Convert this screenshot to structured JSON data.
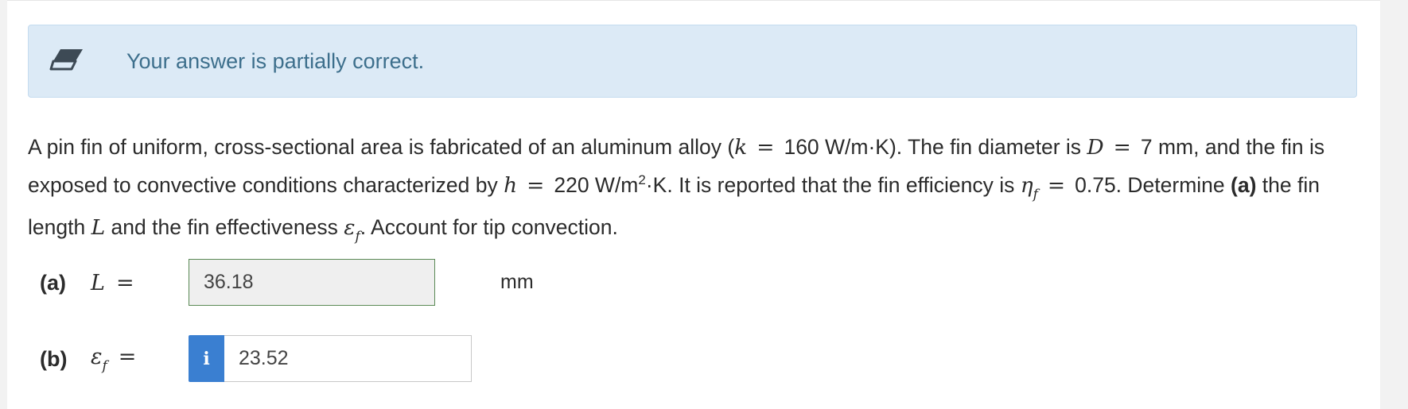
{
  "alert": {
    "icon": "eraser-icon",
    "message": "Your answer is partially correct.",
    "colors": {
      "background": "#dceaf6",
      "text": "#3d6f8c"
    }
  },
  "question": {
    "p1": "A pin fin of uniform, cross-sectional area is fabricated of an aluminum alloy (",
    "k_var": "k",
    "k_eq": "=",
    "k_val": "160 W/m·K). The fin diameter is ",
    "d_var": "D",
    "d_eq": "=",
    "d_val": "7 mm, and the fin is exposed to convective conditions characterized by ",
    "h_var": "h",
    "h_eq": "=",
    "h_val": "220 W/m",
    "h_sup": "2",
    "h_tail": "·K. It is reported that the fin efficiency is ",
    "eta_var": "η",
    "eta_sub": "f",
    "eta_eq": "=",
    "eta_val": "0.75. Determine ",
    "part_a_bold": "(a)",
    "mid": " the fin length ",
    "l_var": "L",
    "and_text": " and the fin effectiveness ",
    "eps_var": "ε",
    "eps_sub": "f",
    "tail": ". Account for tip convection."
  },
  "answers": {
    "a": {
      "part": "(a)",
      "var": "L",
      "eq": "=",
      "value": "36.18",
      "unit": "mm"
    },
    "b": {
      "part": "(b)",
      "var": "ε",
      "var_sub": "f",
      "eq": "=",
      "info_icon": "i",
      "value": "23.52"
    }
  }
}
